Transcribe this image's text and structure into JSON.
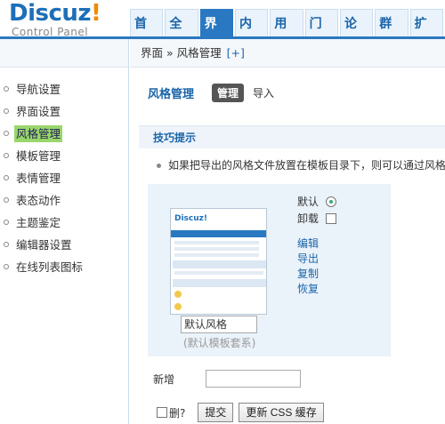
{
  "logo": {
    "word": "Discuz",
    "bang": "!",
    "sub": "Control Panel"
  },
  "nav": {
    "tabs": [
      "首页",
      "全局",
      "界面",
      "内容",
      "用户",
      "门户",
      "论坛",
      "群组",
      "扩展"
    ],
    "active": 2
  },
  "breadcrumb": {
    "text": "界面 » 风格管理",
    "plus": "[+]"
  },
  "sidebar": {
    "items": [
      "导航设置",
      "界面设置",
      "风格管理",
      "模板管理",
      "表情管理",
      "表态动作",
      "主题鉴定",
      "编辑器设置",
      "在线列表图标"
    ],
    "active": 2
  },
  "page": {
    "title": "风格管理",
    "subtabs": [
      "管理",
      "导入"
    ]
  },
  "tips": {
    "heading": "技巧提示",
    "line": "如果把导出的风格文件放置在模板目录下，则可以通过风格"
  },
  "style_item": {
    "thumb_logo": "Discuz!",
    "name_value": "默认风格",
    "desc": "(默认模板套系)",
    "default_label": "默认",
    "uninstall_label": "卸载",
    "links": [
      "编辑",
      "导出",
      "复制",
      "恢复"
    ]
  },
  "add": {
    "label": "新增",
    "value": ""
  },
  "actions": {
    "delete_label": "删?",
    "submit": "提交",
    "update_css": "更新 CSS 缓存"
  },
  "colors": {
    "accent": "#2a78c1",
    "active_side": "#9ad66b"
  }
}
